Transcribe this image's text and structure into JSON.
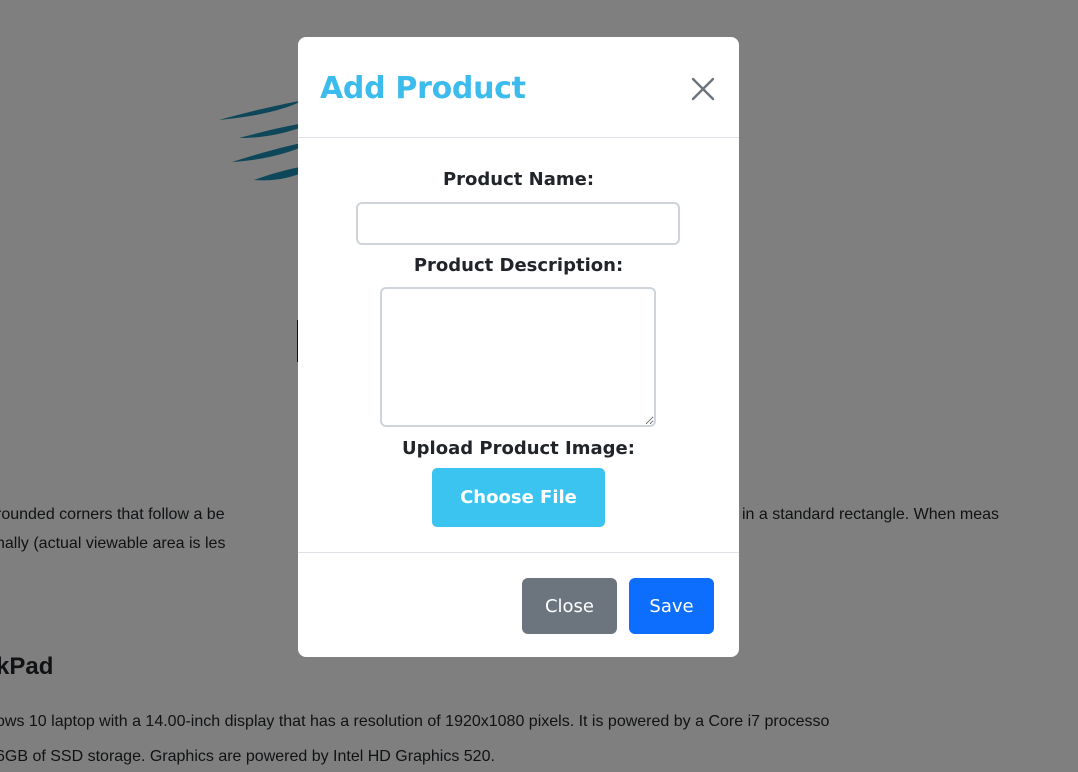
{
  "background": {
    "text_line_1": "rounded corners that follow a be",
    "text_line_1b": "in a standard rectangle. When meas",
    "text_line_2": "nally (actual viewable area is les",
    "heading": "kPad",
    "text_line_5": "ows 10 laptop with a 14.00-inch display that has a resolution of 1920x1080 pixels. It is powered by a Core i7 processo",
    "text_line_6": "6GB of SSD storage. Graphics are powered by Intel HD Graphics 520."
  },
  "modal": {
    "title": "Add Product",
    "close_icon": "close-icon",
    "fields": {
      "name_label": "Product Name:",
      "name_value": "",
      "description_label": "Product Description:",
      "description_value": "",
      "image_label": "Upload Product Image:",
      "choose_file_label": "Choose File"
    },
    "footer": {
      "close_label": "Close",
      "save_label": "Save"
    }
  },
  "colors": {
    "title": "#3cbcec",
    "choose_file": "#3cc4f0",
    "close_button": "#6c757d",
    "save_button": "#0d6efd",
    "backdrop": "rgba(0,0,0,0.5)"
  }
}
